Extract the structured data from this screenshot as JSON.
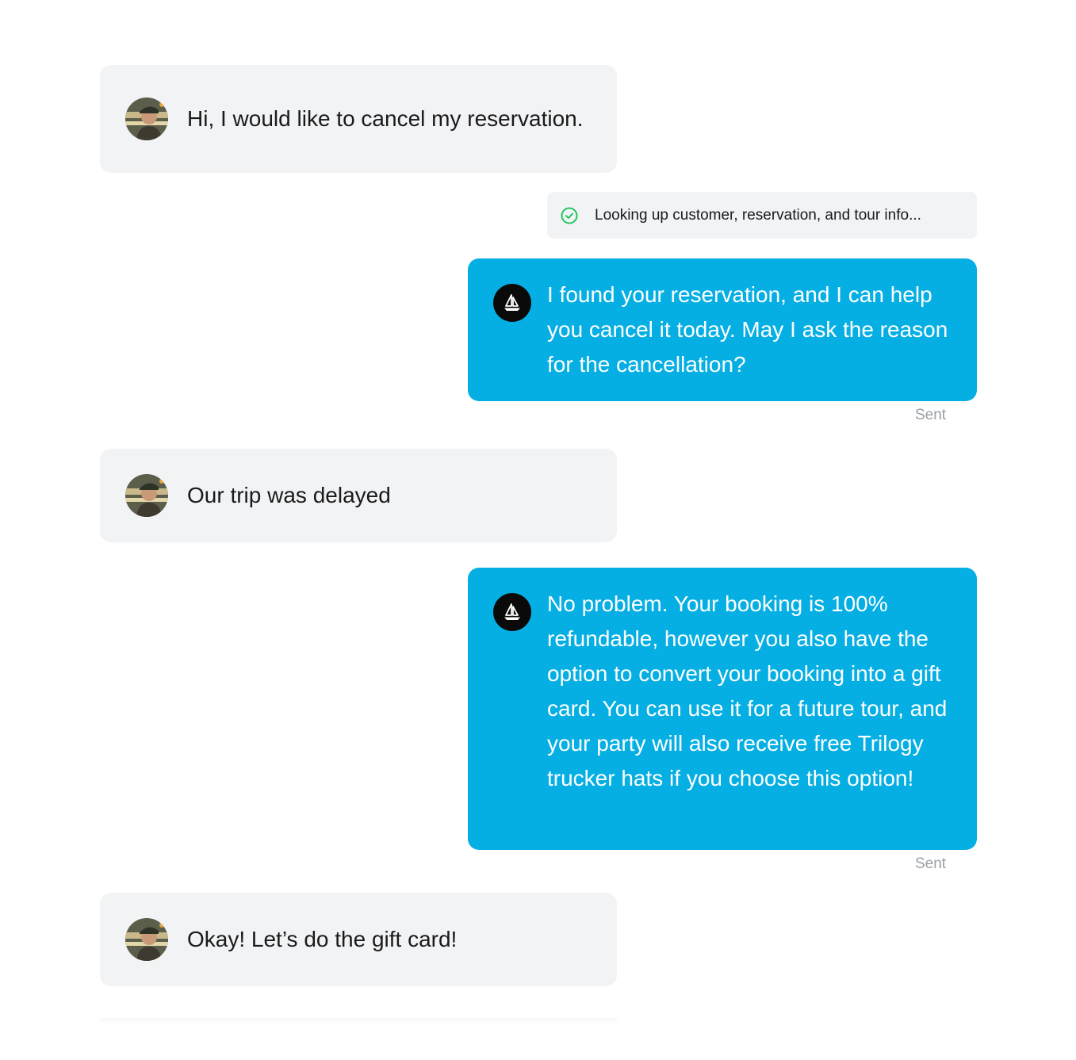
{
  "messages": [
    {
      "role": "customer",
      "text": "Hi, I would like to cancel my reservation.",
      "avatar": "customer-avatar"
    },
    {
      "role": "status",
      "icon": "check-circle-icon",
      "icon_color": "#22c55e",
      "text": "Looking up customer, reservation, and tour info..."
    },
    {
      "role": "agent",
      "text": "I found your reservation, and I can help you cancel it today. May I ask the reason for the cancellation?",
      "status": "Sent",
      "avatar": "sailboat-icon"
    },
    {
      "role": "customer",
      "text": "Our trip was delayed",
      "avatar": "customer-avatar"
    },
    {
      "role": "agent",
      "text": "No problem. Your booking is 100% refundable, however you also have the option to convert your booking into a gift card. You can use it for a future tour, and your party will also receive free Trilogy trucker hats if you choose this option!",
      "status": "Sent",
      "avatar": "sailboat-icon"
    },
    {
      "role": "customer",
      "text": "Okay! Let’s do the gift card!",
      "avatar": "customer-avatar"
    }
  ],
  "colors": {
    "agent_bubble": "#05afe3",
    "customer_bubble": "#f2f3f5",
    "sent_label": "#9aa0a6",
    "bot_avatar": "#0a0a0a"
  }
}
